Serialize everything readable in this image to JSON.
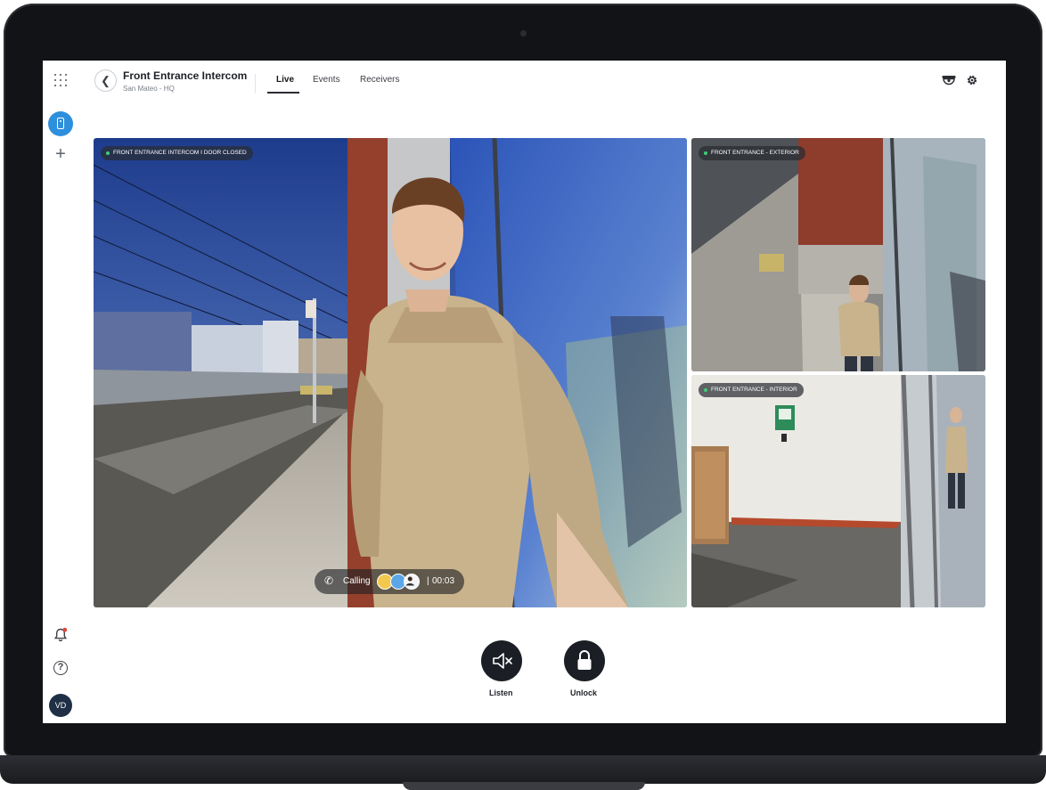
{
  "header": {
    "title": "Front Entrance Intercom",
    "subtitle": "San Mateo - HQ",
    "tabs": [
      {
        "label": "Live",
        "active": true
      },
      {
        "label": "Events",
        "active": false
      },
      {
        "label": "Receivers",
        "active": false
      }
    ],
    "icons": {
      "back": "chevron-left-icon",
      "camera": "dome-camera-icon",
      "settings": "gear-icon"
    }
  },
  "sidebar": {
    "items": [
      {
        "name": "apps-grid-icon"
      },
      {
        "name": "intercom-device-icon",
        "active": true
      },
      {
        "name": "plus-icon",
        "label": "+"
      },
      {
        "name": "bell-icon",
        "has_alert": true
      },
      {
        "name": "help-icon",
        "label": "?"
      }
    ],
    "user_initials": "VD"
  },
  "feeds": {
    "main": {
      "label": "FRONT ENTRANCE INTERCOM I DOOR CLOSED"
    },
    "exterior": {
      "label": "FRONT ENTRANCE - EXTERIOR"
    },
    "interior": {
      "label": "FRONT ENTRANCE - INTERIOR"
    }
  },
  "call": {
    "status": "Calling",
    "separator": "|",
    "elapsed": "00:03"
  },
  "controls": {
    "listen_label": "Listen",
    "unlock_label": "Unlock"
  },
  "colors": {
    "accent": "#2e8fdc",
    "status_online": "#3ccf73",
    "control_bg": "#1b1f25"
  }
}
